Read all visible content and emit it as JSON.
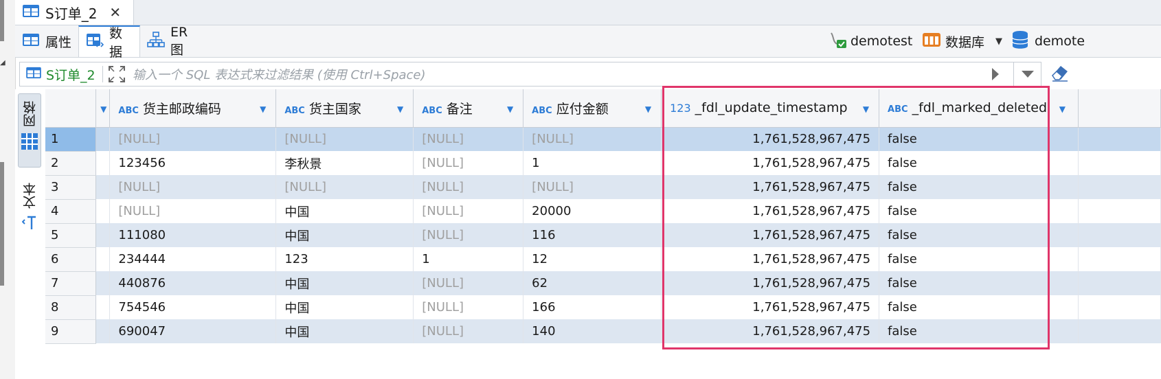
{
  "tab": {
    "title": "S订单_2",
    "close": "✕"
  },
  "subtabs": [
    {
      "label": "属性"
    },
    {
      "label": "数据"
    },
    {
      "label": "ER 图"
    }
  ],
  "connection": {
    "user": "demotest",
    "db_label": "数据库",
    "schema": "demote"
  },
  "filter": {
    "entity": "S订单_2",
    "placeholder": "输入一个 SQL 表达式来过滤结果 (使用 Ctrl+Space)"
  },
  "side_tabs": {
    "grid": "网格",
    "text": "文本"
  },
  "columns": [
    {
      "type": "ABC",
      "name": "货主邮政编码"
    },
    {
      "type": "ABC",
      "name": "货主国家"
    },
    {
      "type": "ABC",
      "name": "备注"
    },
    {
      "type": "ABC",
      "name": "应付金额"
    },
    {
      "type": "123",
      "name": "_fdl_update_timestamp"
    },
    {
      "type": "ABC",
      "name": "_fdl_marked_deleted"
    }
  ],
  "rows": [
    {
      "n": "1",
      "c": [
        "[NULL]",
        "[NULL]",
        "[NULL]",
        "[NULL]",
        "1,761,528,967,475",
        "false"
      ]
    },
    {
      "n": "2",
      "c": [
        "123456",
        "李秋景",
        "[NULL]",
        "1",
        "1,761,528,967,475",
        "false"
      ]
    },
    {
      "n": "3",
      "c": [
        "[NULL]",
        "[NULL]",
        "[NULL]",
        "[NULL]",
        "1,761,528,967,475",
        "false"
      ]
    },
    {
      "n": "4",
      "c": [
        "[NULL]",
        "中国",
        "[NULL]",
        "20000",
        "1,761,528,967,475",
        "false"
      ]
    },
    {
      "n": "5",
      "c": [
        "111080",
        "中国",
        "[NULL]",
        "116",
        "1,761,528,967,475",
        "false"
      ]
    },
    {
      "n": "6",
      "c": [
        "234444",
        "123",
        "1",
        "12",
        "1,761,528,967,475",
        "false"
      ]
    },
    {
      "n": "7",
      "c": [
        "440876",
        "中国",
        "[NULL]",
        "62",
        "1,761,528,967,475",
        "false"
      ]
    },
    {
      "n": "8",
      "c": [
        "754546",
        "中国",
        "[NULL]",
        "166",
        "1,761,528,967,475",
        "false"
      ]
    },
    {
      "n": "9",
      "c": [
        "690047",
        "中国",
        "[NULL]",
        "140",
        "1,761,528,967,475",
        "false"
      ]
    }
  ],
  "colors": {
    "accent": "#2d7cd6",
    "highlight": "#e0356a",
    "stripe": "#dde6f1",
    "selected": "#c4d8ee"
  }
}
